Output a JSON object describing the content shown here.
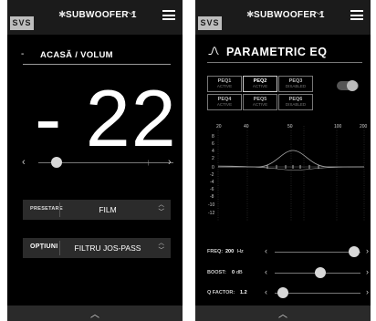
{
  "colors": {
    "background": "#000000",
    "bar": "#1b1b1b",
    "panel": "#2b2b2b",
    "thumb": "#d8d8d8",
    "accent_logo": "#bdbdbd"
  },
  "header": {
    "logo": "SVS",
    "device": "SUBWOOFER 1",
    "bt_icon": "bluetooth-icon",
    "chevron_icon": "chevron-down-icon",
    "menu_icon": "menu-icon"
  },
  "volume_screen": {
    "breadcrumb_dash": "-",
    "breadcrumb": "ACASĂ / VOLUM",
    "volume_display": "- 22",
    "volume_level_fraction": 0.1,
    "preset": {
      "label": "PRESETARE",
      "value": "FILM"
    },
    "options": {
      "label": "OPȚIUNI",
      "value": "FILTRU JOS-PASS"
    }
  },
  "eq_screen": {
    "title": "PARAMETRIC EQ",
    "peqs": [
      {
        "name": "PEQ1",
        "status": "ACTIVE"
      },
      {
        "name": "PEQ2",
        "status": "ACTIVE",
        "selected": true
      },
      {
        "name": "PEQ3",
        "status": "DISABLED"
      },
      {
        "name": "PEQ4",
        "status": "ACTIVE"
      },
      {
        "name": "PEQ5",
        "status": "ACTIVE"
      },
      {
        "name": "PEQ6",
        "status": "DISABLED"
      }
    ],
    "toggle_on": true,
    "graph": {
      "x_labels": [
        "20",
        "40",
        "50",
        "100",
        "200"
      ],
      "y_labels": [
        "8",
        "6",
        "4",
        "2",
        "0",
        "-2",
        "-4",
        "-6",
        "-8",
        "-10",
        "-12"
      ]
    },
    "controls": [
      {
        "label": "FREQ:",
        "value": "200",
        "unit": "Hz",
        "level": 0.93
      },
      {
        "label": "BOOST:",
        "value": "0",
        "unit": "dB",
        "level": 0.53
      },
      {
        "label": "Q FACTOR:",
        "value": "1.2",
        "unit": "",
        "level": 0.1
      }
    ]
  },
  "footer": {
    "chevron_up": "chevron-up-icon"
  }
}
